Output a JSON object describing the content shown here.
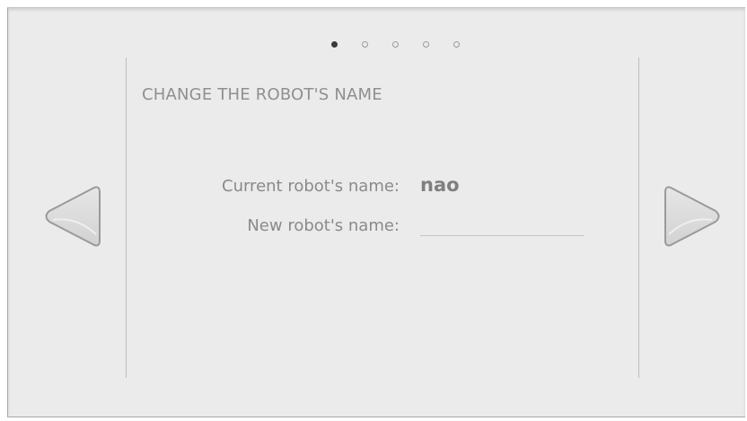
{
  "pagination": {
    "total": 5,
    "active_index": 0
  },
  "title": "CHANGE THE ROBOT'S NAME",
  "current_name": {
    "label": "Current robot's name:",
    "value": "nao"
  },
  "new_name": {
    "label": "New robot's name:",
    "value": "",
    "placeholder": ""
  },
  "nav": {
    "prev_icon": "triangle-left-icon",
    "next_icon": "triangle-right-icon"
  },
  "colors": {
    "background": "#ebebeb",
    "text": "#8a8a8a",
    "arrow_fill": "#dcdcdc",
    "arrow_stroke": "#9a9a9a"
  }
}
